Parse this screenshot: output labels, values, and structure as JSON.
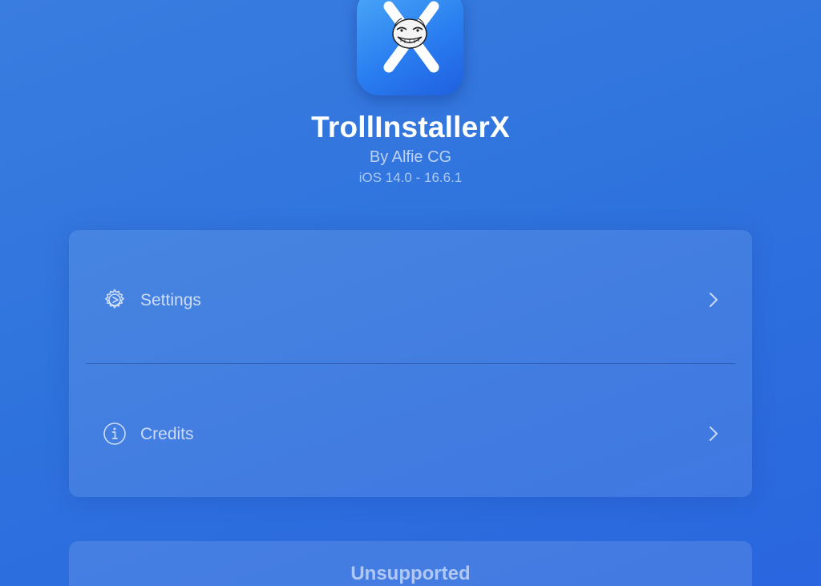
{
  "app": {
    "title": "TrollInstallerX",
    "author": "By Alfie CG",
    "version_range": "iOS 14.0 - 16.6.1",
    "icon": "app-icon-x-trollface"
  },
  "menu": {
    "items": [
      {
        "label": "Settings",
        "icon": "gear-icon",
        "chevron": "chevron-right-icon"
      },
      {
        "label": "Credits",
        "icon": "info-circle-icon",
        "chevron": "chevron-right-icon"
      }
    ]
  },
  "action": {
    "label": "Unsupported"
  },
  "colors": {
    "background": "#2f73dd",
    "text": "#ffffff"
  }
}
